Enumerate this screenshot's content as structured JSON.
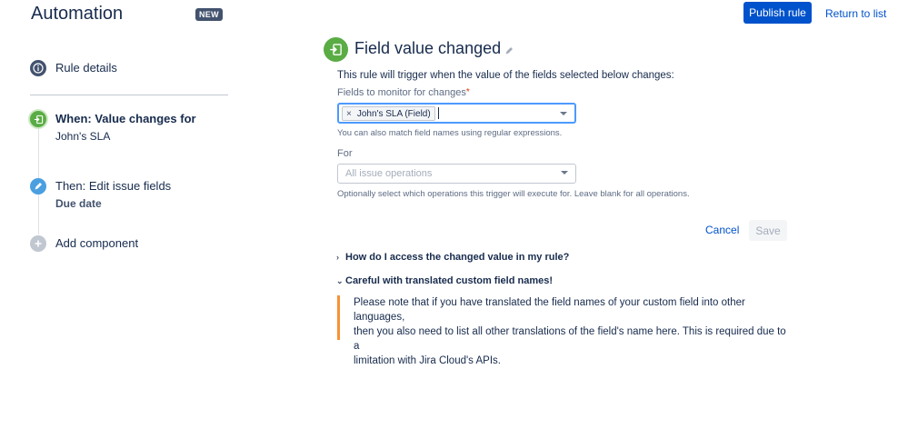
{
  "header": {
    "title": "Automation",
    "badge": "NEW",
    "publish_label": "Publish rule",
    "return_label": "Return to list"
  },
  "sidebar": {
    "rule_details": "Rule details",
    "trigger_label": "When: Value changes for",
    "trigger_sub": "John's SLA",
    "action_label": "Then: Edit issue fields",
    "action_sub": "Due date",
    "add_label": "Add component"
  },
  "main": {
    "title": "Field value changed",
    "description": "This rule will trigger when the value of the fields selected below changes:",
    "fields_label": "Fields to monitor for changes",
    "required_marker": "*",
    "selected_tag": "John's SLA (Field)",
    "tag_remove": "×",
    "fields_hint": "You can also match field names using regular expressions.",
    "for_label": "For",
    "for_placeholder": "All issue operations",
    "for_hint": "Optionally select which operations this trigger will execute for. Leave blank for all operations.",
    "cancel_label": "Cancel",
    "save_label": "Save",
    "expander1": "How do I access the changed value in my rule?",
    "expander2": "Careful with translated custom field names!",
    "note_line1": "Please note that if you have translated the field names of your custom field into other languages,",
    "note_line2": "then you also need to list all other translations of the field's name here. This is required due to a",
    "note_line3": "limitation with Jira Cloud's APIs."
  },
  "colors": {
    "primary": "#0052cc",
    "trigger_green": "#5aac44",
    "action_blue": "#4a9fe0",
    "warning_orange": "#f79233"
  }
}
